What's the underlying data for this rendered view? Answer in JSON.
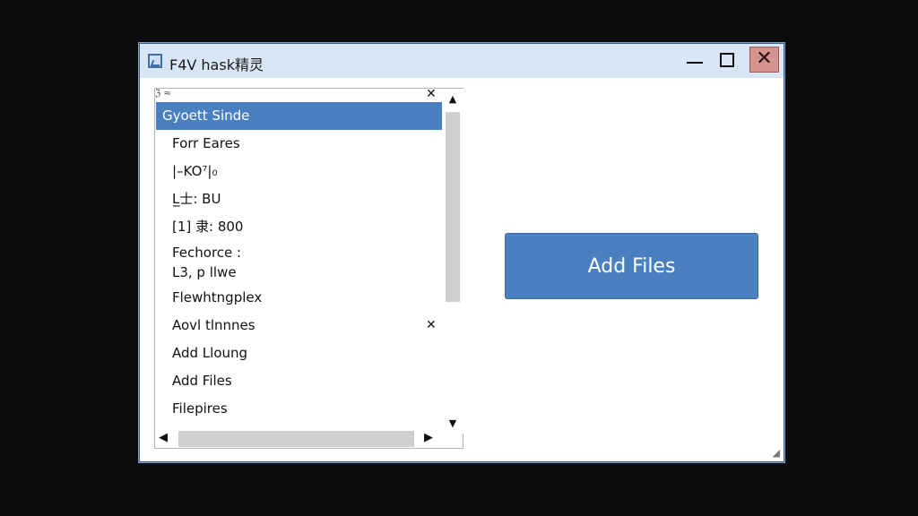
{
  "window": {
    "title": "F4V hask精灵",
    "icon": "image-icon",
    "controls": {
      "minimize_icon": "minimize-icon",
      "maximize_icon": "maximize-icon",
      "close_symbol": "✕"
    }
  },
  "list": {
    "header_label": "ℨ ≈",
    "header_close": "✕",
    "items": [
      {
        "label": "Gyoett Sinde",
        "selected": true
      },
      {
        "label": "Forr Eares"
      },
      {
        "label": "|–KO⁷|₀"
      },
      {
        "label": "L̲士: BU"
      },
      {
        "label": "[1] 隶: 800"
      },
      {
        "label": "Fechorce  :",
        "label2": "L3, p  llwe"
      },
      {
        "label": "Flewhtngplex"
      },
      {
        "label": "Aovl tlnnnes",
        "remove": "✕"
      },
      {
        "label": "Add Lloung"
      },
      {
        "label": "Add Files"
      },
      {
        "label": "Filepires"
      }
    ],
    "scroll_up": "▲",
    "scroll_down": "▼",
    "scroll_left": "◀",
    "scroll_right": "▶"
  },
  "actions": {
    "add_files_label": "Add Files"
  },
  "colors": {
    "accent": "#4a80c0",
    "titlebar": "#d8e6f5",
    "close_button": "#d4938f"
  }
}
